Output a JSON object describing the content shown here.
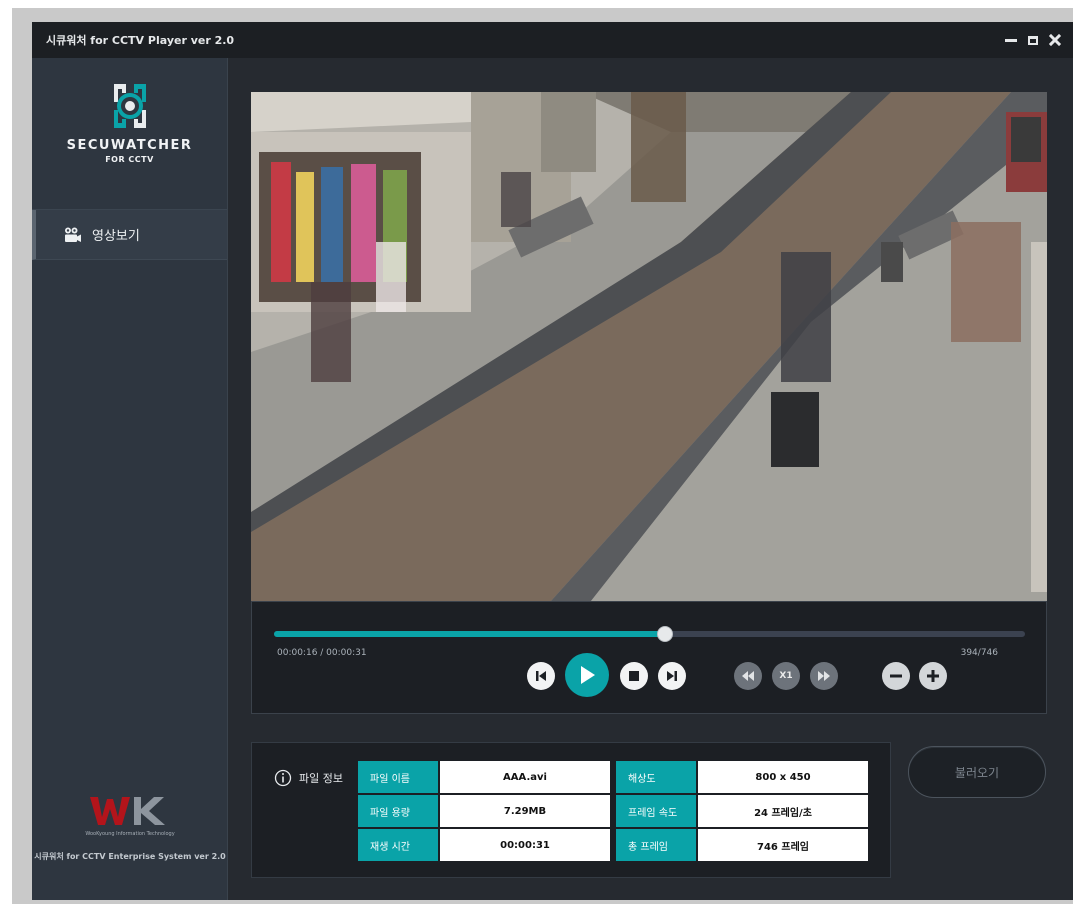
{
  "window": {
    "title": "시큐워처 for CCTV Player ver 2.0"
  },
  "sidebar": {
    "brand_name": "SECUWATCHER",
    "brand_sub": "FOR CCTV",
    "items": [
      {
        "label": "영상보기",
        "icon": "camera-icon",
        "active": true
      }
    ],
    "footer_logo_sub": "WooKyoung Information Technology",
    "footer_text": "시큐워처 for CCTV Enterprise System ver 2.0"
  },
  "player": {
    "time": "00:00:16 / 00:00:31",
    "frame": "394/746",
    "progress": 0.52,
    "speed_label": "X1",
    "buttons": [
      "skip-previous-icon",
      "play-icon",
      "stop-icon",
      "skip-next-icon",
      "rewind-icon",
      "fast-forward-icon",
      "zoom-out-icon",
      "zoom-in-icon"
    ]
  },
  "file_info": {
    "title": "파일 정보",
    "rows": [
      {
        "k1": "파일 이름",
        "v1": "AAA.avi",
        "k2": "해상도",
        "v2": "800 x 450"
      },
      {
        "k1": "파일 용량",
        "v1": "7.29MB",
        "k2": "프레임 속도",
        "v2": "24 프레임/초"
      },
      {
        "k1": "재생 시간",
        "v1": "00:00:31",
        "k2": "총 프레임",
        "v2": "746 프레임"
      }
    ]
  },
  "load_button": "불러오기",
  "colors": {
    "accent": "#0aa3a8",
    "background": "#262a30",
    "sidebar": "#2e3640",
    "logo_red": "#b3141b"
  }
}
